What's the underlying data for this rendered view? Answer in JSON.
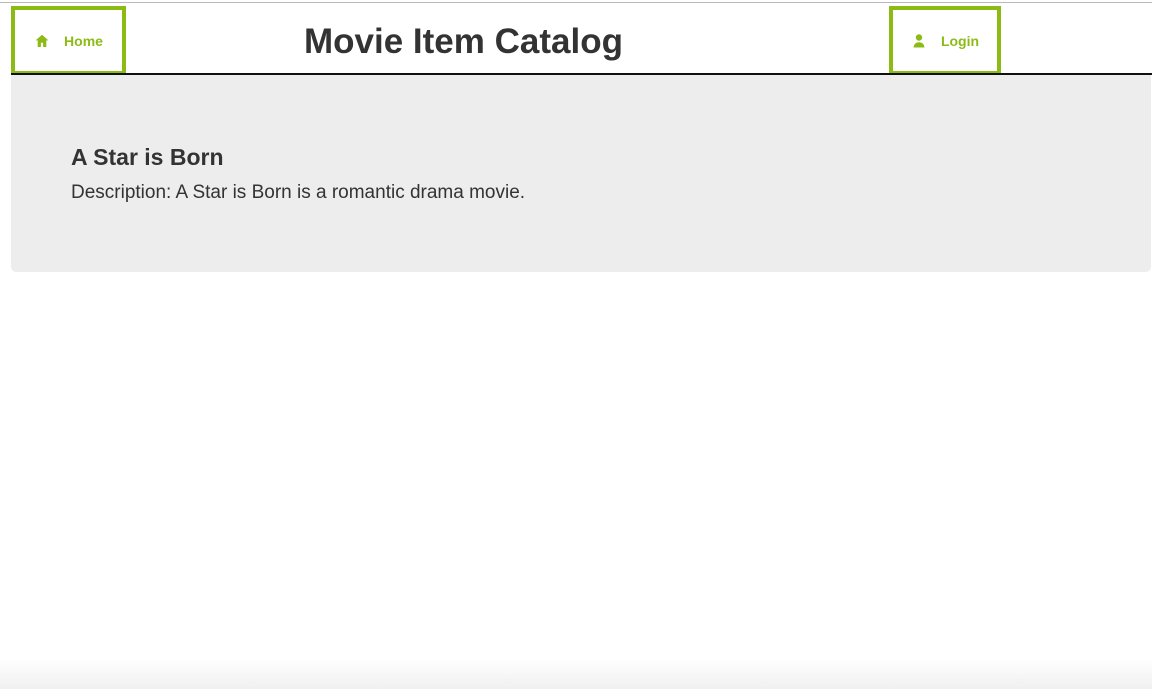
{
  "header": {
    "title": "Movie Item Catalog",
    "home_label": "Home",
    "login_label": "Login"
  },
  "item": {
    "name": "A Star is Born",
    "description": "Description: A Star is Born is a romantic drama movie."
  },
  "icons": {
    "home": "home-icon",
    "login": "user-icon"
  },
  "colors": {
    "accent": "#8dbb16",
    "text": "#333333",
    "panel": "#ededed"
  }
}
